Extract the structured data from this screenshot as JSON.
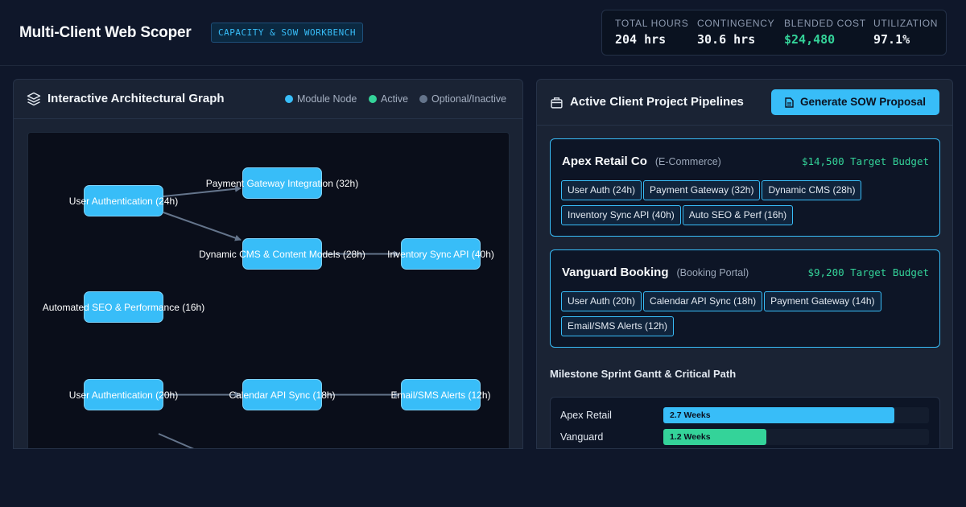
{
  "header": {
    "title": "Multi-Client Web Scoper",
    "badge": "CAPACITY & SOW WORKBENCH",
    "stats": [
      {
        "label": "TOTAL HOURS",
        "value": "204 hrs",
        "color": "#f1f5f9"
      },
      {
        "label": "CONTINGENCY",
        "value": "30.6 hrs",
        "color": "#f1f5f9"
      },
      {
        "label": "BLENDED COST",
        "value": "$24,480",
        "color": "#34d399"
      },
      {
        "label": "UTILIZATION",
        "value": "97.1%",
        "color": "#f1f5f9"
      }
    ]
  },
  "graph_panel": {
    "title": "Interactive Architectural Graph",
    "icon": "layers-icon",
    "legend": [
      {
        "label": "Module Node",
        "color": "#38bdf8"
      },
      {
        "label": "Active",
        "color": "#34d399"
      },
      {
        "label": "Optional/Inactive",
        "color": "#64748b"
      }
    ],
    "nodes": [
      {
        "id": "n1",
        "label": "User Authentication (24h)"
      },
      {
        "id": "n2",
        "label": "Payment Gateway Integration (32h)"
      },
      {
        "id": "n3",
        "label": "Dynamic CMS & Content Models (28h)"
      },
      {
        "id": "n4",
        "label": "Inventory Sync API (40h)"
      },
      {
        "id": "n5",
        "label": "Automated SEO & Performance (16h)"
      },
      {
        "id": "n6",
        "label": "User Authentication (20h)"
      },
      {
        "id": "n7",
        "label": "Calendar API Sync (18h)"
      },
      {
        "id": "n8",
        "label": "Email/SMS Alerts (12h)"
      }
    ],
    "edges": [
      {
        "from": "n1",
        "to": "n2"
      },
      {
        "from": "n1",
        "to": "n3"
      },
      {
        "from": "n3",
        "to": "n4"
      },
      {
        "from": "n6",
        "to": "n7"
      },
      {
        "from": "n7",
        "to": "n8"
      }
    ]
  },
  "pipelines_panel": {
    "title": "Active Client Project Pipelines",
    "icon": "briefcase-icon",
    "generate_button": "Generate SOW Proposal",
    "generate_icon": "document-icon",
    "clients": [
      {
        "name": "Apex Retail Co",
        "type": "(E-Commerce)",
        "budget": "$14,500 Target Budget",
        "modules": [
          "User Auth (24h)",
          "Payment Gateway (32h)",
          "Dynamic CMS (28h)",
          "Inventory Sync API (40h)",
          "Auto SEO & Perf (16h)"
        ]
      },
      {
        "name": "Vanguard Booking",
        "type": "(Booking Portal)",
        "budget": "$9,200 Target Budget",
        "modules": [
          "User Auth (20h)",
          "Calendar API Sync (18h)",
          "Payment Gateway (14h)",
          "Email/SMS Alerts (12h)"
        ]
      }
    ],
    "gantt": {
      "title": "Milestone Sprint Gantt & Critical Path",
      "max_weeks": 3.1,
      "rows": [
        {
          "label": "Apex Retail",
          "weeks": 2.7,
          "bar_label": "2.7 Weeks",
          "color": "#38bdf8"
        },
        {
          "label": "Vanguard",
          "weeks": 1.2,
          "bar_label": "1.2 Weeks",
          "color": "#34d399"
        }
      ]
    }
  }
}
